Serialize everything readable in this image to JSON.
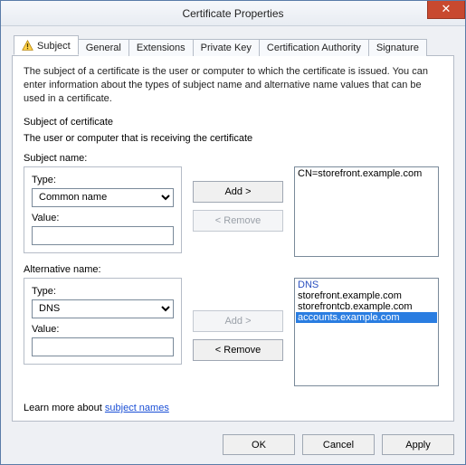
{
  "window": {
    "title": "Certificate Properties"
  },
  "tabs": [
    {
      "label": "Subject"
    },
    {
      "label": "General"
    },
    {
      "label": "Extensions"
    },
    {
      "label": "Private Key"
    },
    {
      "label": "Certification Authority"
    },
    {
      "label": "Signature"
    }
  ],
  "description": "The subject of a certificate is the user or computer to which the certificate is issued. You can enter information about the types of subject name and alternative name values that can be used in a certificate.",
  "section_header1": "Subject of certificate",
  "section_header2": "The user or computer that is receiving the certificate",
  "subject": {
    "heading": "Subject name:",
    "type_label": "Type:",
    "type_value": "Common name",
    "value_label": "Value:",
    "value_value": "",
    "add_label": "Add >",
    "remove_label": "< Remove",
    "list": [
      "CN=storefront.example.com"
    ]
  },
  "alt": {
    "heading": "Alternative name:",
    "type_label": "Type:",
    "type_value": "DNS",
    "value_label": "Value:",
    "value_value": "",
    "add_label": "Add >",
    "remove_label": "< Remove",
    "list_head": "DNS",
    "list": [
      "storefront.example.com",
      "storefrontcb.example.com",
      "accounts.example.com"
    ],
    "selected_index": 2
  },
  "learn": {
    "prefix": "Learn more about ",
    "link": "subject names"
  },
  "buttons": {
    "ok": "OK",
    "cancel": "Cancel",
    "apply": "Apply"
  }
}
